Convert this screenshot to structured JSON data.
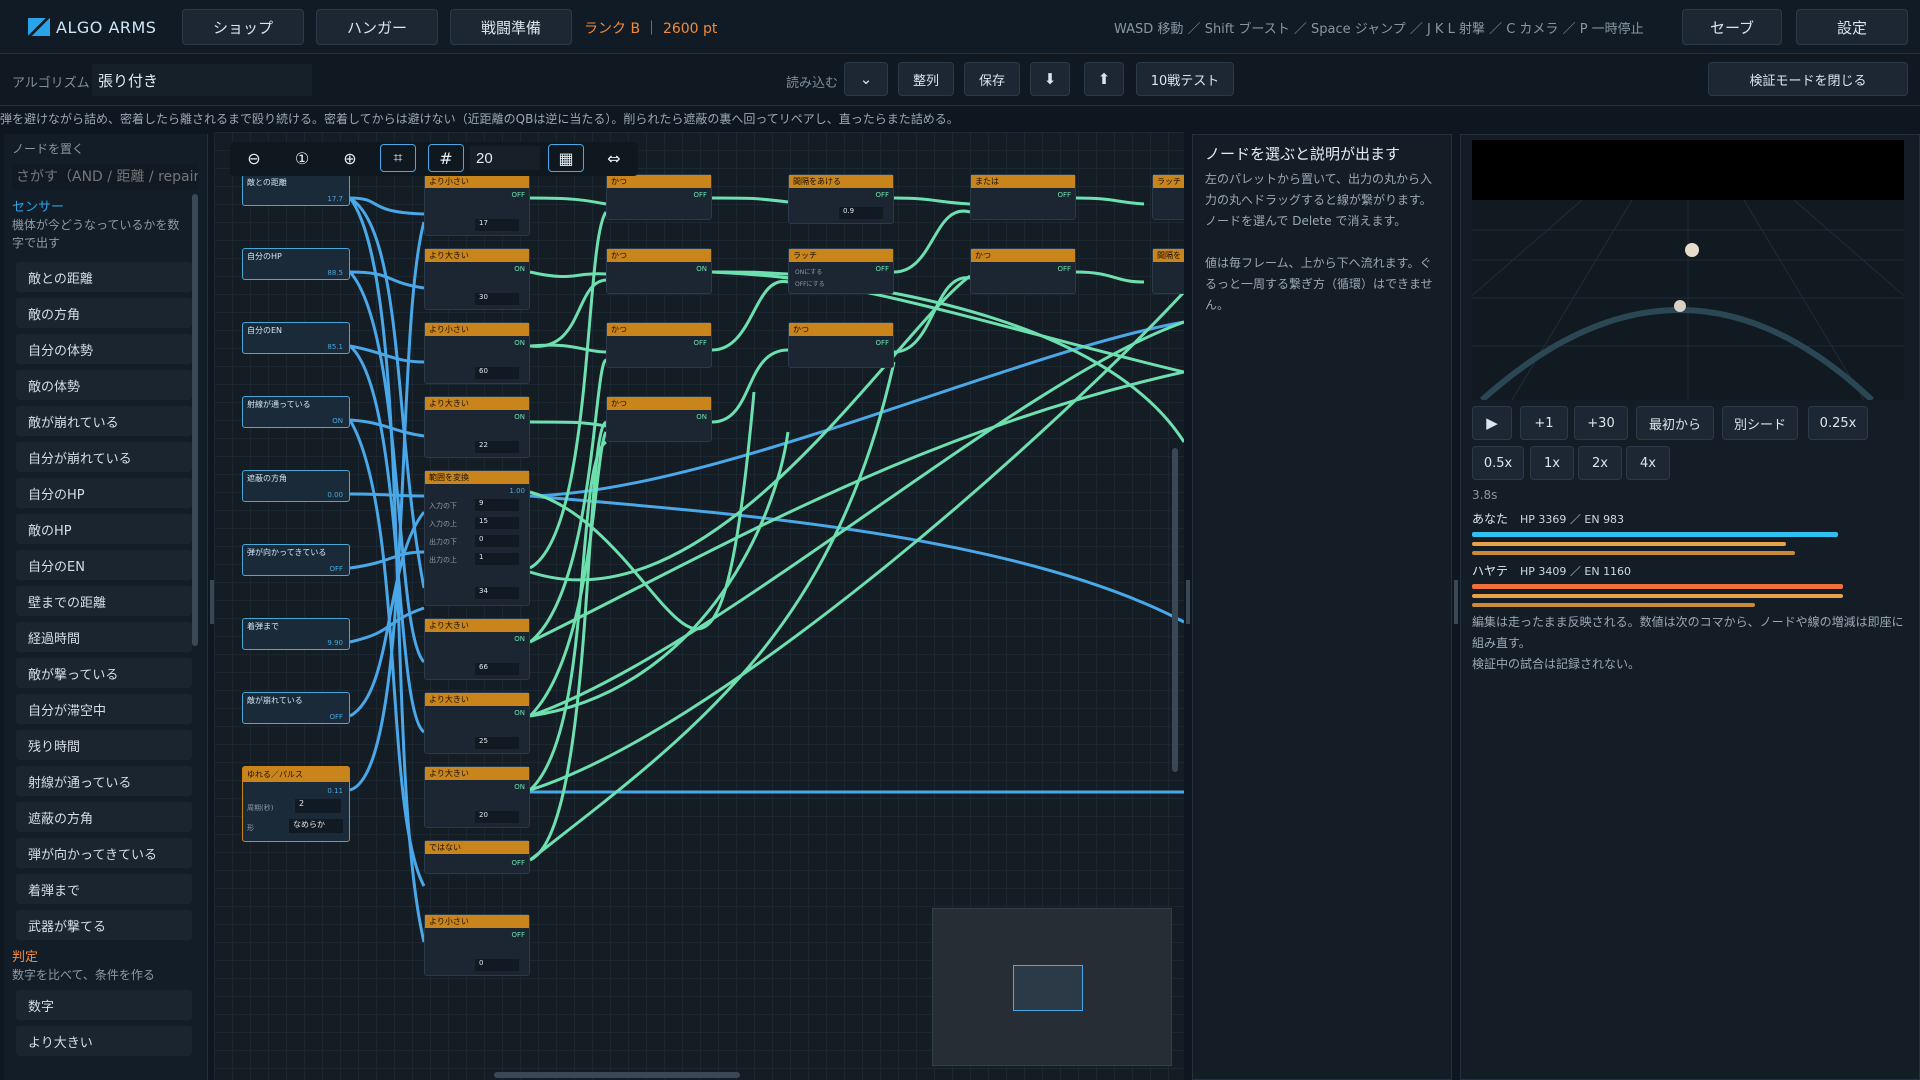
{
  "header": {
    "logo": "ALGO ARMS",
    "tabs": [
      "ショップ",
      "ハンガー",
      "戦闘準備"
    ],
    "rank": "ランク B ｜ 2600 pt",
    "hints": "WASD 移動 ／ Shift ブースト ／ Space ジャンプ ／ J K L 射撃 ／ C カメラ ／ P 一時停止",
    "save": "セーブ",
    "settings": "設定"
  },
  "toolbar": {
    "algo_label": "アルゴリズム",
    "algo_name": "張り付き",
    "load_label": "読み込む",
    "arrange": "整列",
    "save": "保存",
    "test": "10戦テスト",
    "close_verify": "検証モードを閉じる"
  },
  "description": "弾を避けながら詰め、密着したら離されるまで殴り続ける。密着してからは避けない（近距離のQBは逆に当たる）。削られたら遮蔽の裏へ回ってリペアし、直ったらまた詰める。",
  "palette": {
    "title": "ノードを置く",
    "search_placeholder": "さがす（AND / 距離 / repair）",
    "sensor_title": "センサー",
    "sensor_sub": "機体が今どうなっているかを数字で出す",
    "sensors": [
      "敵との距離",
      "敵の方角",
      "自分の体勢",
      "敵の体勢",
      "敵が崩れている",
      "自分が崩れている",
      "自分のHP",
      "敵のHP",
      "自分のEN",
      "壁までの距離",
      "経過時間",
      "敵が撃っている",
      "自分が滞空中",
      "残り時間",
      "射線が通っている",
      "遮蔽の方角",
      "弾が向かってきている",
      "着弾まで",
      "武器が撃てる"
    ],
    "judge_title": "判定",
    "judge_sub": "数字を比べて、条件を作る",
    "judges": [
      "数字",
      "より大きい"
    ]
  },
  "canvas": {
    "zoom": "20"
  },
  "nodes": {
    "sensors": [
      {
        "label": "敵との距離",
        "value": "17.7"
      },
      {
        "label": "自分のHP",
        "value": "88.5"
      },
      {
        "label": "自分のEN",
        "value": "85.1"
      },
      {
        "label": "射線が通っている",
        "value": "ON"
      },
      {
        "label": "遮蔽の方角",
        "value": "0.00"
      },
      {
        "label": "弾が向かってきている",
        "value": "OFF"
      },
      {
        "label": "着弾まで",
        "value": "9.90"
      },
      {
        "label": "敵が崩れている",
        "value": "OFF"
      }
    ],
    "pulse": {
      "label": "ゆれる／パルス",
      "value": "0.11",
      "period_label": "周期(秒)",
      "period": "2",
      "shape_label": "形",
      "shape": "なめらか"
    },
    "compares": [
      {
        "label": "より小さい",
        "out": "OFF",
        "b": "17"
      },
      {
        "label": "より大きい",
        "out": "ON",
        "b": "30"
      },
      {
        "label": "より小さい",
        "out": "ON",
        "b": "60"
      },
      {
        "label": "より大きい",
        "out": "ON",
        "b": "22"
      },
      {
        "label": "より大きい",
        "out": "ON",
        "b": "66"
      },
      {
        "label": "より大きい",
        "out": "ON",
        "b": "25"
      },
      {
        "label": "より大きい",
        "out": "ON",
        "b": "20"
      }
    ],
    "not": {
      "label": "ではない",
      "out": "OFF"
    },
    "last": {
      "label": "より小さい",
      "out": "OFF",
      "b": "0"
    },
    "range": {
      "label": "範囲を変換",
      "out": "1.00",
      "in_lo_label": "入力の下",
      "in_lo": "9",
      "in_hi_label": "入力の上",
      "in_hi": "15",
      "out_lo_label": "出力の下",
      "out_lo": "0",
      "out_hi_label": "出力の上",
      "out_hi": "1",
      "b": "34"
    },
    "ands": [
      {
        "label": "かつ",
        "out": "OFF"
      },
      {
        "label": "かつ",
        "out": "ON"
      },
      {
        "label": "かつ",
        "out": "OFF"
      },
      {
        "label": "かつ",
        "out": "ON"
      }
    ],
    "col3": [
      {
        "label": "間隔をあける",
        "out": "OFF",
        "val": "0.9"
      },
      {
        "label": "ラッチ",
        "out": "OFF",
        "in1": "ONにする",
        "in2": "OFFにする"
      },
      {
        "label": "かつ",
        "out": "OFF"
      }
    ],
    "col4": [
      {
        "label": "または",
        "out": "OFF"
      },
      {
        "label": "かつ",
        "out": "OFF"
      }
    ],
    "col5": [
      {
        "label": "ラッチ"
      },
      {
        "label": "間隔を"
      }
    ]
  },
  "info": {
    "title": "ノードを選ぶと説明が出ます",
    "p1": "左のパレットから置いて、出力の丸から入力の丸へドラッグすると線が繋がります。ノードを選んで Delete で消えます。",
    "p2": "値は毎フレーム、上から下へ流れます。ぐるっと一周する繋ぎ方（循環）はできません。"
  },
  "sim": {
    "controls": [
      "▶",
      "+1",
      "+30",
      "最初から",
      "別シード",
      "0.25x"
    ],
    "speeds": [
      "0.5x",
      "1x",
      "2x",
      "4x"
    ],
    "time": "3.8s",
    "player_name": "あなた",
    "player_stats": "HP 3369 ／ EN 983",
    "enemy_name": "ハヤテ",
    "enemy_stats": "HP 3409 ／ EN 1160",
    "note1": "編集は走ったまま反映される。数値は次のコマから、ノードや線の増減は即座に組み直す。",
    "note2": "検証中の試合は記録されない。"
  },
  "bars": {
    "player_hp": 0.84,
    "player_en": 0.72,
    "player_en2": 0.74,
    "enemy_hp": 0.85,
    "enemy_en": 0.85,
    "enemy_en2": 0.65
  },
  "colors": {
    "accent": "#2aa4e8",
    "orange": "#f08a3a",
    "sensor": "#4aa8d8",
    "node_head": "#c9841c",
    "wire_on": "#6ee0b0",
    "wire_blue": "#4aa8e8"
  }
}
